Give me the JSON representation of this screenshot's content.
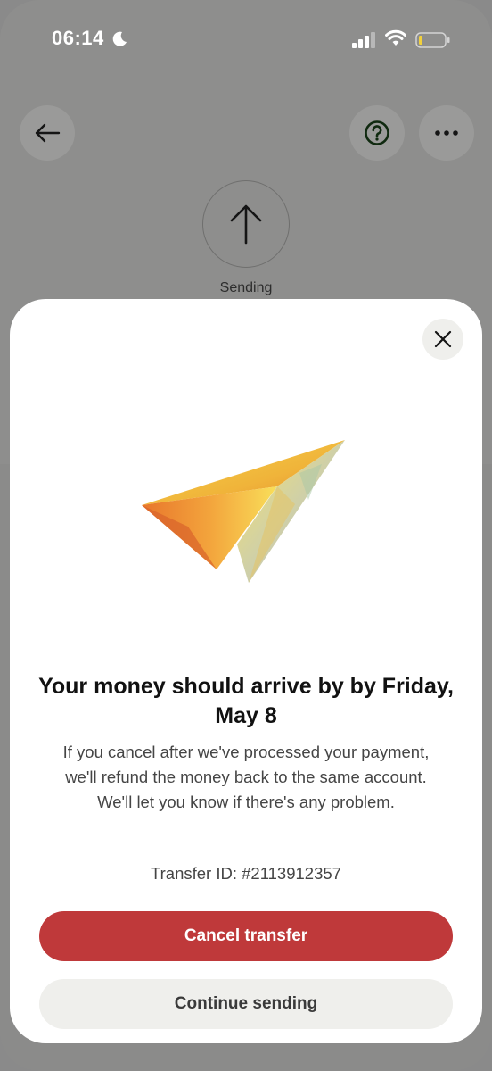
{
  "status_bar": {
    "time": "06:14",
    "icons": [
      "moon-icon",
      "signal-icon",
      "wifi-icon",
      "battery-icon"
    ]
  },
  "header": {
    "back_icon": "arrow-left-icon",
    "help_icon": "question-circle-icon",
    "more_icon": "more-horizontal-icon"
  },
  "status": {
    "icon": "arrow-up-icon",
    "label": "Sending"
  },
  "modal": {
    "close_icon": "close-icon",
    "illustration": "paper-plane-illustration",
    "headline": "Your money should arrive by by Friday, May 8",
    "body": "If you cancel after we've processed your payment, we'll refund the money back to the same account. We'll let you know if there's any problem.",
    "transfer_id": "Transfer ID: #2113912357",
    "cancel_label": "Cancel transfer",
    "continue_label": "Continue sending"
  },
  "colors": {
    "cancel_button": "#bf393a",
    "continue_button": "#efefec",
    "overlay": "#8e8e8d"
  }
}
